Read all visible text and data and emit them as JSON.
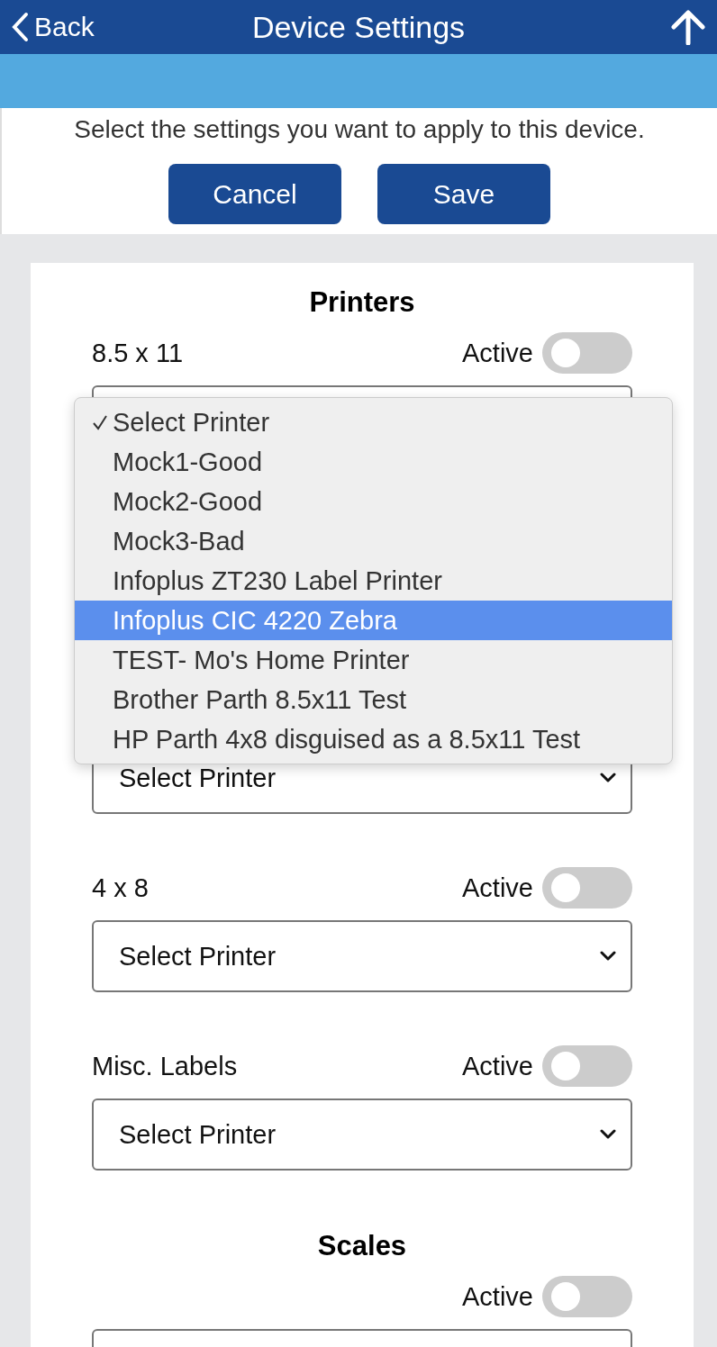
{
  "header": {
    "back": "Back",
    "title": "Device Settings"
  },
  "instruction": "Select the settings you want to apply to this device.",
  "buttons": [
    "Cancel",
    "Save"
  ],
  "printers": {
    "title": "Printers",
    "groups": [
      {
        "label": "8.5 x 11",
        "active_label": "Active",
        "active": false
      },
      {
        "value": "Select Printer"
      },
      {
        "label": "4 x 8",
        "active_label": "Active",
        "active": false,
        "value": "Select Printer"
      },
      {
        "label": "Misc. Labels",
        "active_label": "Active",
        "active": false,
        "value": "Select Printer"
      }
    ],
    "open_menu": [
      {
        "label": "Select Printer",
        "checked": true,
        "highlighted": false
      },
      {
        "label": "Mock1-Good",
        "checked": false,
        "highlighted": false
      },
      {
        "label": "Mock2-Good",
        "checked": false,
        "highlighted": false
      },
      {
        "label": "Mock3-Bad",
        "checked": false,
        "highlighted": false
      },
      {
        "label": "Infoplus ZT230 Label Printer",
        "checked": false,
        "highlighted": false
      },
      {
        "label": "Infoplus CIC 4220 Zebra",
        "checked": false,
        "highlighted": true
      },
      {
        "label": "TEST- Mo's Home Printer",
        "checked": false,
        "highlighted": false
      },
      {
        "label": "Brother Parth 8.5x11 Test",
        "checked": false,
        "highlighted": false
      },
      {
        "label": "HP Parth 4x8 disguised as a 8.5x11 Test",
        "checked": false,
        "highlighted": false
      }
    ]
  },
  "scales": {
    "title": "Scales",
    "active_label": "Active",
    "active": false
  }
}
